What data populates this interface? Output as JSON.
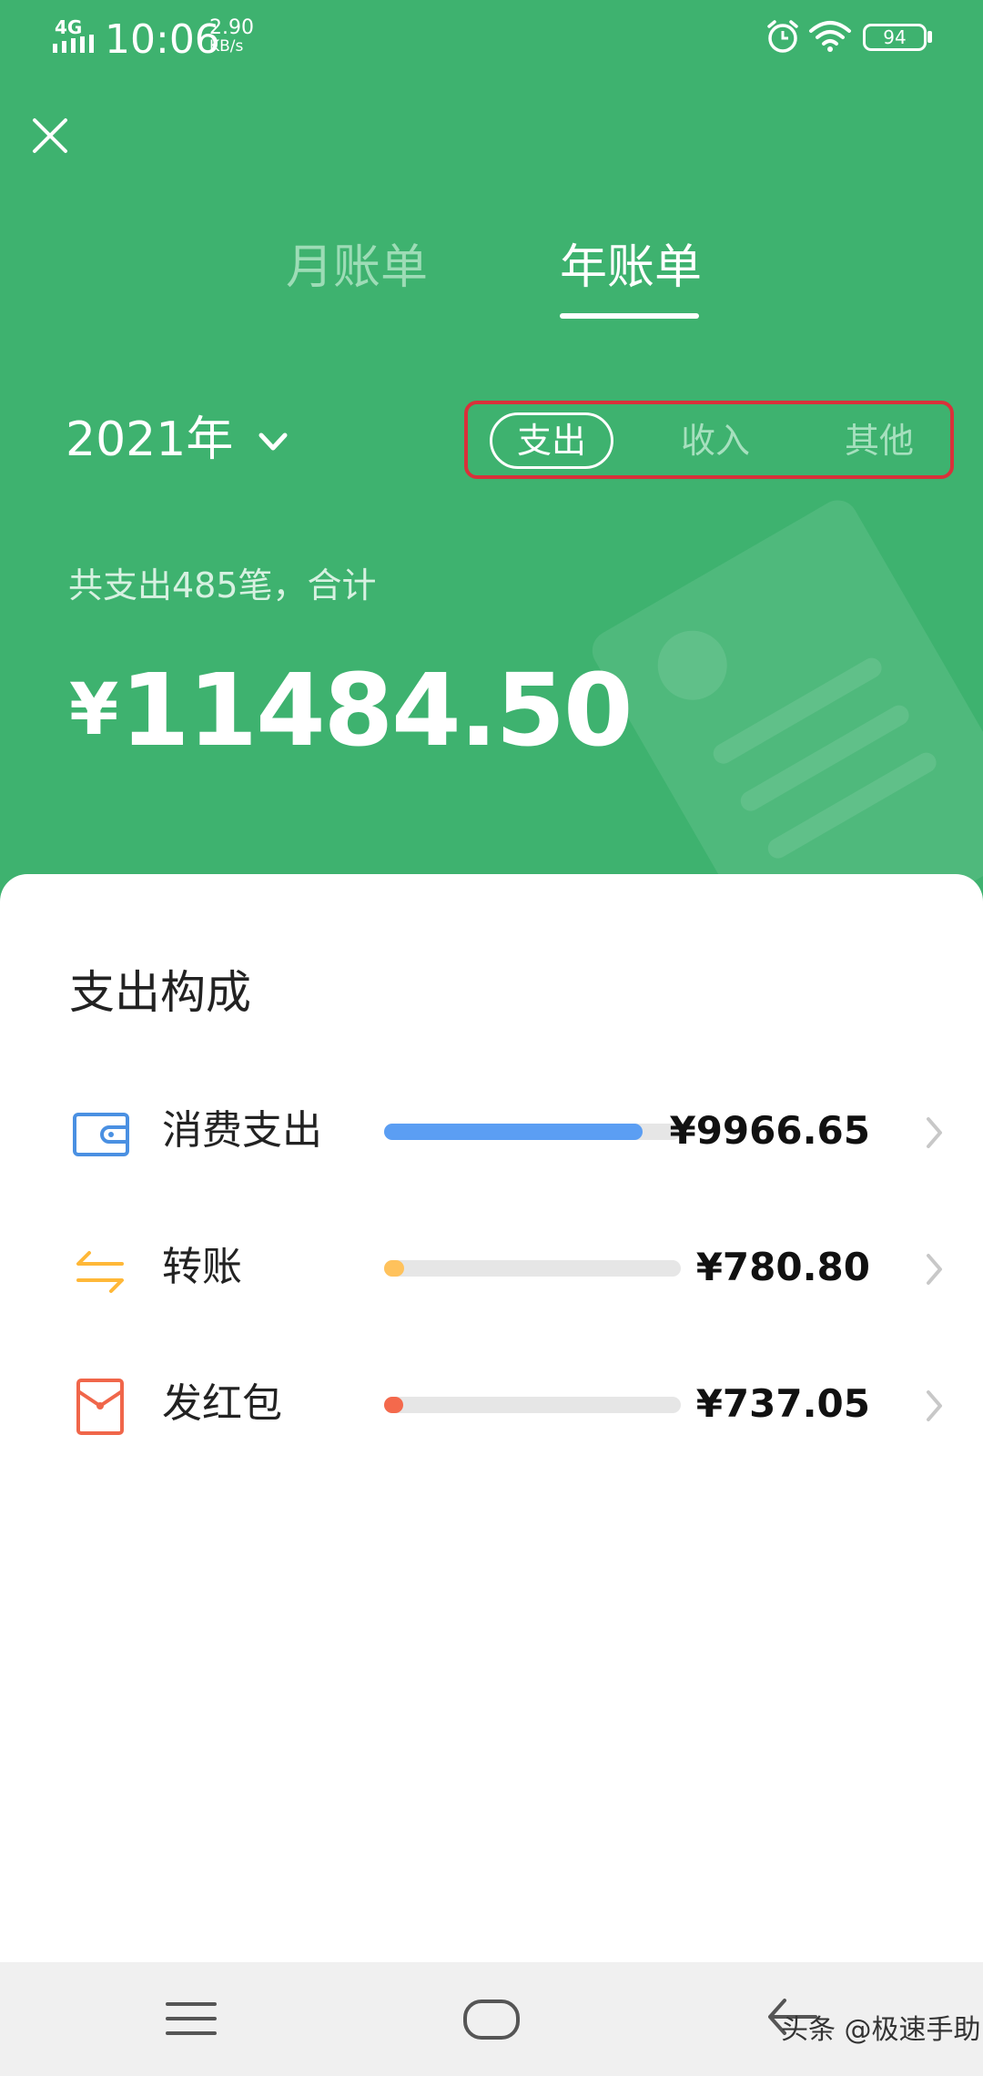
{
  "status_bar": {
    "time": "10:06",
    "network": "4G",
    "speed_value": "2.90",
    "speed_unit": "KB/s",
    "battery": "94",
    "icons": [
      "signal-icon",
      "alarm-icon",
      "wifi-icon",
      "battery-icon"
    ]
  },
  "header": {
    "close_icon": "close-icon",
    "tabs": [
      {
        "label": "月账单",
        "active": false
      },
      {
        "label": "年账单",
        "active": true
      }
    ],
    "year_label": "2021年",
    "year_dropdown_icon": "chevron-down-icon",
    "segments": [
      {
        "label": "支出",
        "active": true
      },
      {
        "label": "收入",
        "active": false
      },
      {
        "label": "其他",
        "active": false
      }
    ],
    "summary_text": "共支出485笔，合计",
    "total_currency": "¥",
    "total_amount": "11484.50"
  },
  "breakdown": {
    "title": "支出构成",
    "rows": [
      {
        "label": "消费支出",
        "amount": "¥9966.65",
        "ratio": 0.87,
        "color": "#5b9ef3",
        "icon": "wallet-icon"
      },
      {
        "label": "转账",
        "amount": "¥780.80",
        "ratio": 0.068,
        "color": "#ffc25c",
        "icon": "transfer-arrows-icon"
      },
      {
        "label": "发红包",
        "amount": "¥737.05",
        "ratio": 0.064,
        "color": "#f4694c",
        "icon": "red-envelope-icon"
      }
    ]
  },
  "nav_bar": {
    "icons": [
      "menu-icon",
      "home-icon",
      "back-icon"
    ]
  },
  "watermark": "头条 @极速手助",
  "colors": {
    "primary_green": "#3eb26f",
    "highlight_red": "#d9313a"
  }
}
